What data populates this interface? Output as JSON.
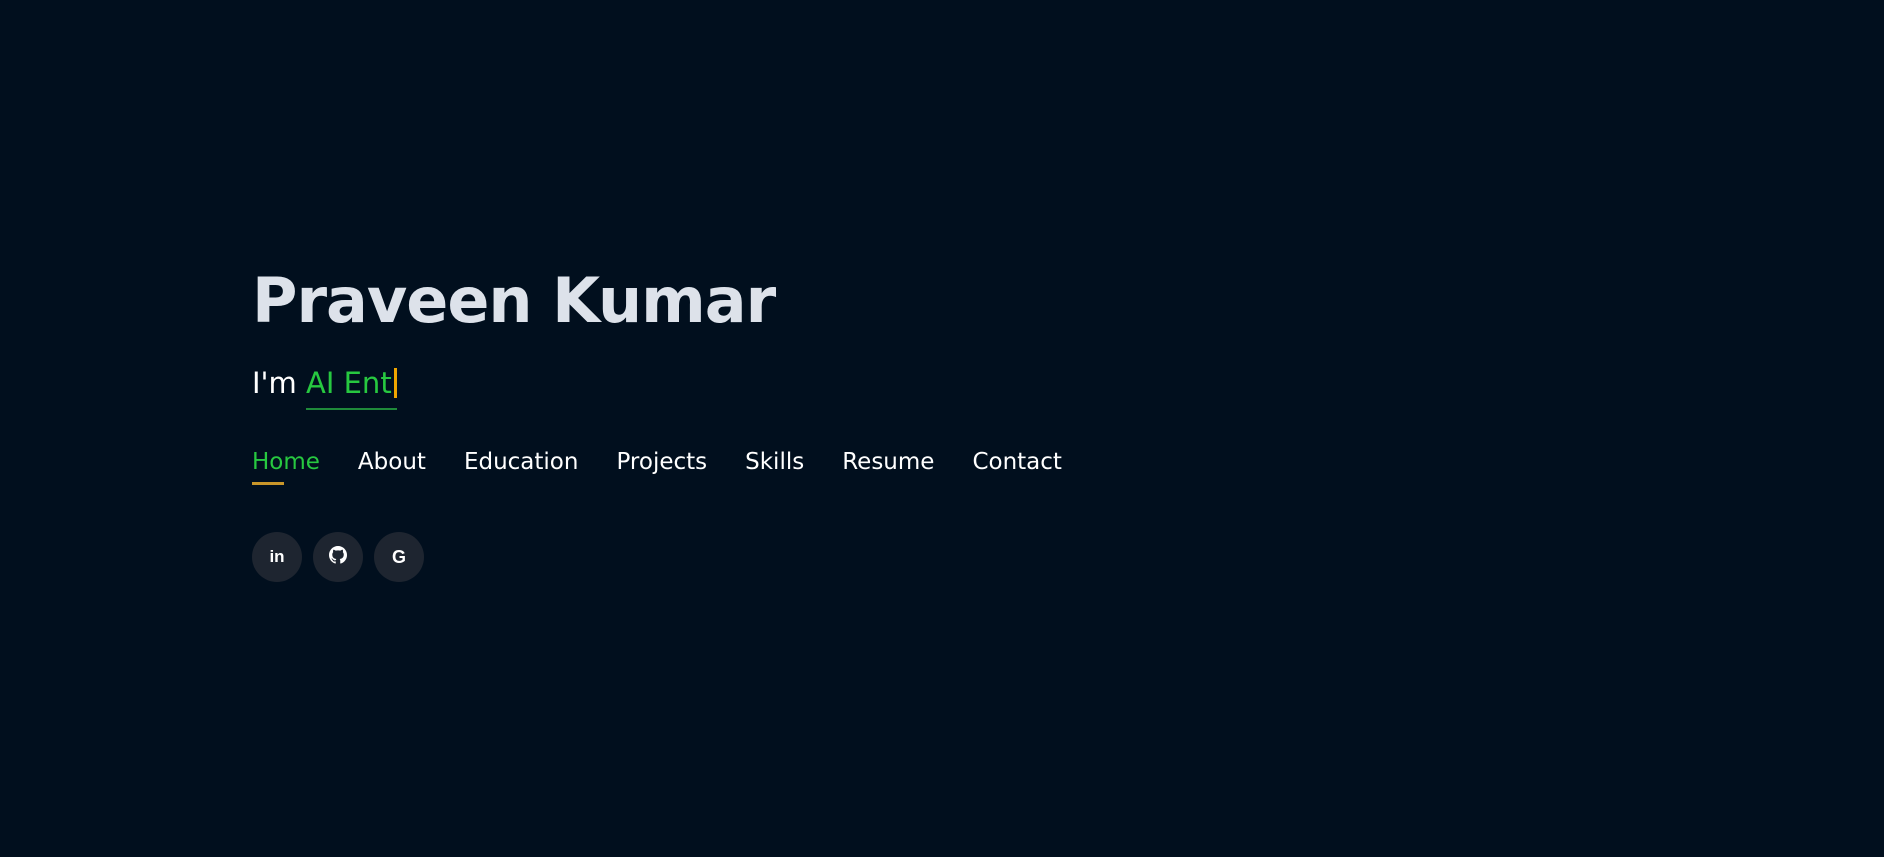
{
  "hero": {
    "name": "Praveen Kumar",
    "tagline_prefix": "I'm ",
    "typed_text": "AI Ent"
  },
  "nav": {
    "items": [
      {
        "label": "Home",
        "active": true
      },
      {
        "label": "About",
        "active": false
      },
      {
        "label": "Education",
        "active": false
      },
      {
        "label": "Projects",
        "active": false
      },
      {
        "label": "Skills",
        "active": false
      },
      {
        "label": "Resume",
        "active": false
      },
      {
        "label": "Contact",
        "active": false
      }
    ]
  },
  "social": {
    "linkedin_glyph": "in",
    "linkedin_icon": "linkedin-icon",
    "github_icon": "github-icon",
    "google_glyph": "G",
    "google_icon": "google-icon"
  },
  "colors": {
    "background": "#010f1e",
    "accent_green": "#27c840",
    "underline_gold": "#c9962a",
    "caret": "#f0a500",
    "social_bg": "#1e2530"
  }
}
